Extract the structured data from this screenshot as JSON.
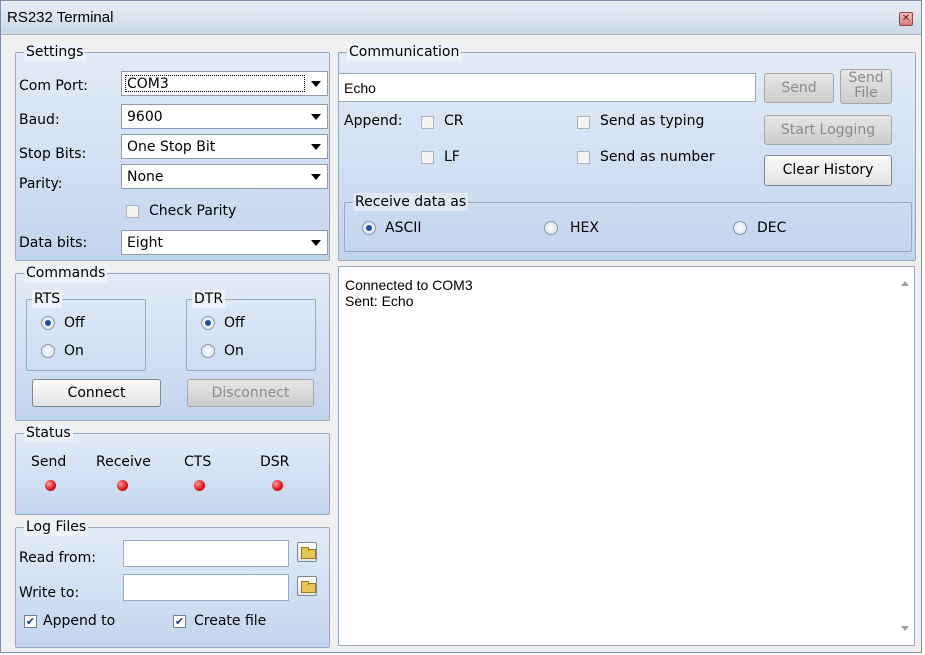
{
  "window": {
    "title": "RS232 Terminal",
    "close_glyph": "✕"
  },
  "settings": {
    "group_label": "Settings",
    "com_port_label": "Com Port:",
    "com_port_value": "COM3",
    "baud_label": "Baud:",
    "baud_value": "9600",
    "stop_bits_label": "Stop Bits:",
    "stop_bits_value": "One Stop Bit",
    "parity_label": "Parity:",
    "parity_value": "None",
    "check_parity_label": "Check Parity",
    "check_parity_checked": false,
    "data_bits_label": "Data bits:",
    "data_bits_value": "Eight"
  },
  "commands": {
    "group_label": "Commands",
    "rts": {
      "label": "RTS",
      "off_label": "Off",
      "on_label": "On",
      "selected": "Off"
    },
    "dtr": {
      "label": "DTR",
      "off_label": "Off",
      "on_label": "On",
      "selected": "Off"
    },
    "connect_label": "Connect",
    "disconnect_label": "Disconnect"
  },
  "status": {
    "group_label": "Status",
    "indicators": [
      {
        "label": "Send",
        "color": "#e01010"
      },
      {
        "label": "Receive",
        "color": "#e01010"
      },
      {
        "label": "CTS",
        "color": "#e01010"
      },
      {
        "label": "DSR",
        "color": "#e01010"
      }
    ]
  },
  "log_files": {
    "group_label": "Log Files",
    "read_from_label": "Read from:",
    "read_from_value": "",
    "write_to_label": "Write to:",
    "write_to_value": "",
    "append_to_label": "Append to",
    "append_to_checked": true,
    "create_file_label": "Create file",
    "create_file_checked": true
  },
  "communication": {
    "group_label": "Communication",
    "input_value": "Echo",
    "send_label": "Send",
    "send_file_label_line1": "Send",
    "send_file_label_line2": "File",
    "append_label": "Append:",
    "cr_label": "CR",
    "lf_label": "LF",
    "send_as_typing_label": "Send as typing",
    "send_as_number_label": "Send as number",
    "start_logging_label": "Start Logging",
    "clear_history_label": "Clear History"
  },
  "receive": {
    "group_label": "Receive data as",
    "options": [
      "ASCII",
      "HEX",
      "DEC"
    ],
    "selected": "ASCII"
  },
  "history": {
    "lines": [
      "Connected to COM3",
      "Sent: Echo"
    ]
  }
}
